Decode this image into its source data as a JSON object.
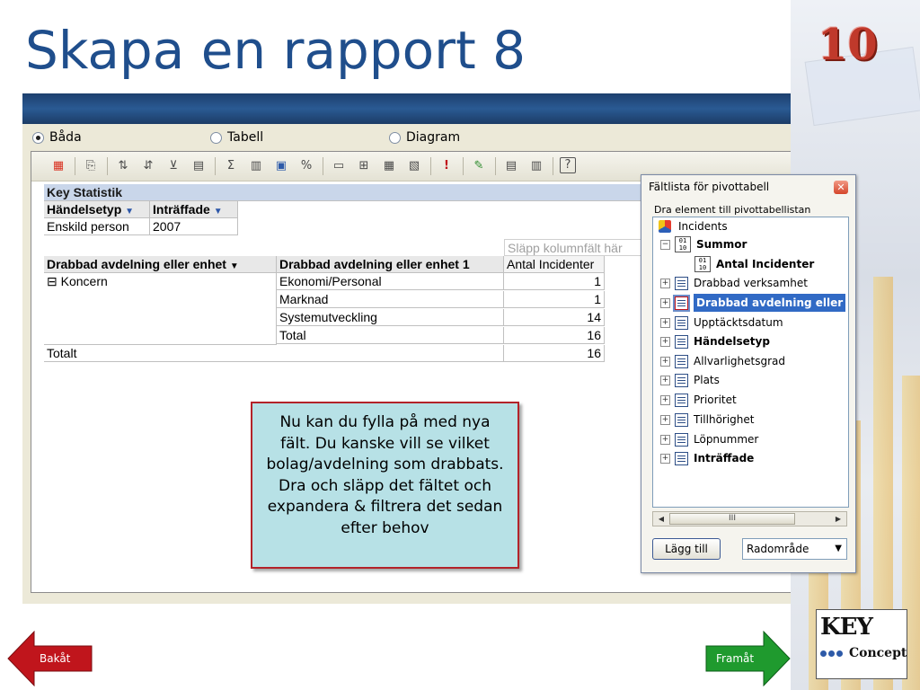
{
  "slide": {
    "title": "Skapa en rapport 8",
    "page_number": "10",
    "callout": "Nu kan du fylla på med nya fält. Du kanske vill se vilket bolag/avdelning som drabbats. Dra och släpp det fältet och expandera & filtrera det sedan efter behov",
    "nav_back": "Bakåt",
    "nav_forward": "Framåt",
    "logo_top": "KEY",
    "logo_bottom": "Concept"
  },
  "options": {
    "both": "Båda",
    "table": "Tabell",
    "chart": "Diagram",
    "selected": "both"
  },
  "pivot": {
    "header": "Key Statistik",
    "filter_fields": [
      "Händelsetyp",
      "Inträffade"
    ],
    "filter_values": [
      "Enskild person",
      "2007"
    ],
    "drop_column_hint": "Släpp kolumnfält här",
    "row_headers": [
      "Drabbad avdelning eller enhet",
      "Drabbad avdelning eller enhet 1",
      "Antal Incidenter"
    ],
    "group": "⊟ Koncern",
    "rows": [
      {
        "label": "Ekonomi/Personal",
        "value": "1"
      },
      {
        "label": "Marknad",
        "value": "1"
      },
      {
        "label": "Systemutveckling",
        "value": "14"
      },
      {
        "label": "Total",
        "value": "16"
      }
    ],
    "grand_total_label": "Totalt",
    "grand_total_value": "16"
  },
  "field_list": {
    "title": "Fältlista för pivottabell",
    "subtitle": "Dra element till pivottabellistan",
    "root": "Incidents",
    "summary_group": "Summor",
    "summary_item": "Antal Incidenter",
    "fields": [
      {
        "label": "Drabbad verksamhet",
        "bold": false,
        "selected": false
      },
      {
        "label": "Drabbad avdelning eller",
        "bold": true,
        "selected": true
      },
      {
        "label": "Upptäcktsdatum",
        "bold": false,
        "selected": false
      },
      {
        "label": "Händelsetyp",
        "bold": true,
        "selected": false
      },
      {
        "label": "Allvarlighetsgrad",
        "bold": false,
        "selected": false
      },
      {
        "label": "Plats",
        "bold": false,
        "selected": false
      },
      {
        "label": "Prioritet",
        "bold": false,
        "selected": false
      },
      {
        "label": "Tillhörighet",
        "bold": false,
        "selected": false
      },
      {
        "label": "Löpnummer",
        "bold": false,
        "selected": false
      },
      {
        "label": "Inträffade",
        "bold": true,
        "selected": false
      }
    ],
    "add_button": "Lägg till",
    "area_select": "Radområde",
    "scroll_glyph": "III"
  },
  "colors": {
    "title": "#1f4e8c",
    "page_number": "#c0392b",
    "callout_bg": "#b7e1e6",
    "callout_border": "#b3232a",
    "back_arrow": "#c0151c",
    "forward_arrow": "#1f9a2e"
  }
}
